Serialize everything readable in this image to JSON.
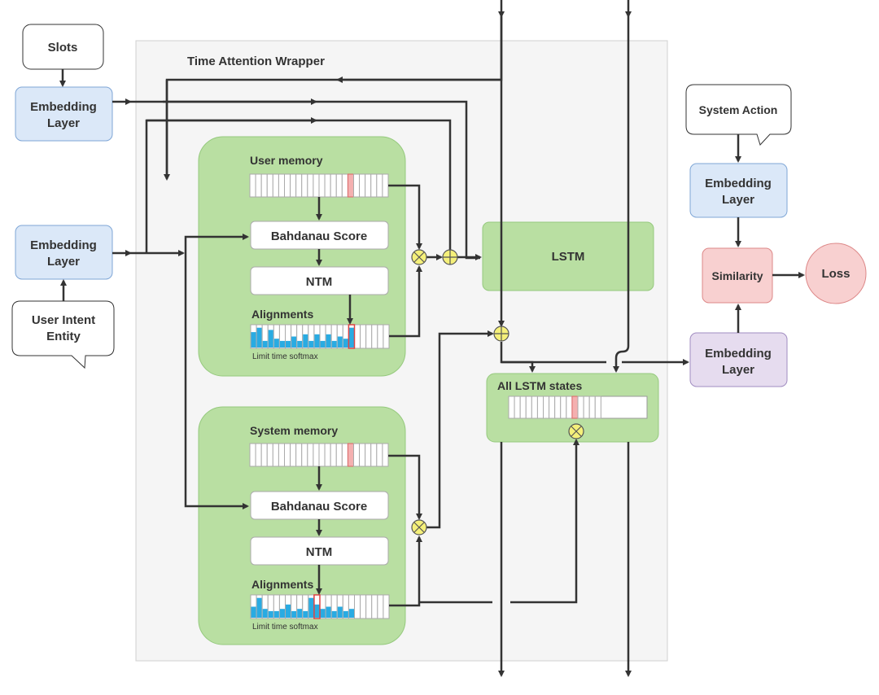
{
  "wrapper_title": "Time Attention Wrapper",
  "inputs": {
    "slots": "Slots",
    "user_intent_line1": "User Intent",
    "user_intent_line2": "Entity",
    "system_action": "System Action"
  },
  "embedding": {
    "line1": "Embedding",
    "line2": "Layer"
  },
  "user_block": {
    "memory_label": "User memory",
    "score_label": "Bahdanau Score",
    "ntm_label": "NTM",
    "alignments_label": "Alignments",
    "softmax_label": "Limit time softmax",
    "alignment_levels": [
      0.7,
      0.9,
      0.3,
      0.8,
      0.4,
      0.3,
      0.3,
      0.5,
      0.3,
      0.6,
      0.3,
      0.6,
      0.3,
      0.6,
      0.3,
      0.5,
      0.4,
      0.9
    ]
  },
  "system_block": {
    "memory_label": "System memory",
    "score_label": "Bahdanau Score",
    "ntm_label": "NTM",
    "alignments_label": "Alignments",
    "softmax_label": "Limit time softmax",
    "alignment_levels": [
      0.5,
      0.9,
      0.4,
      0.3,
      0.3,
      0.4,
      0.6,
      0.3,
      0.4,
      0.3,
      0.9,
      0.6,
      0.4,
      0.5,
      0.3,
      0.5,
      0.3,
      0.4
    ]
  },
  "lstm_label": "LSTM",
  "all_states_label": "All LSTM states",
  "similarity_label": "Similarity",
  "loss_label": "Loss",
  "colors": {
    "green": "#b9dfa2",
    "blue": "#dbe8f8",
    "purple": "#e6dcef",
    "pink": "#f8d0d0",
    "operator": "#f5f07a",
    "bar": "#29abe2",
    "highlight": "#f4b0b0"
  }
}
